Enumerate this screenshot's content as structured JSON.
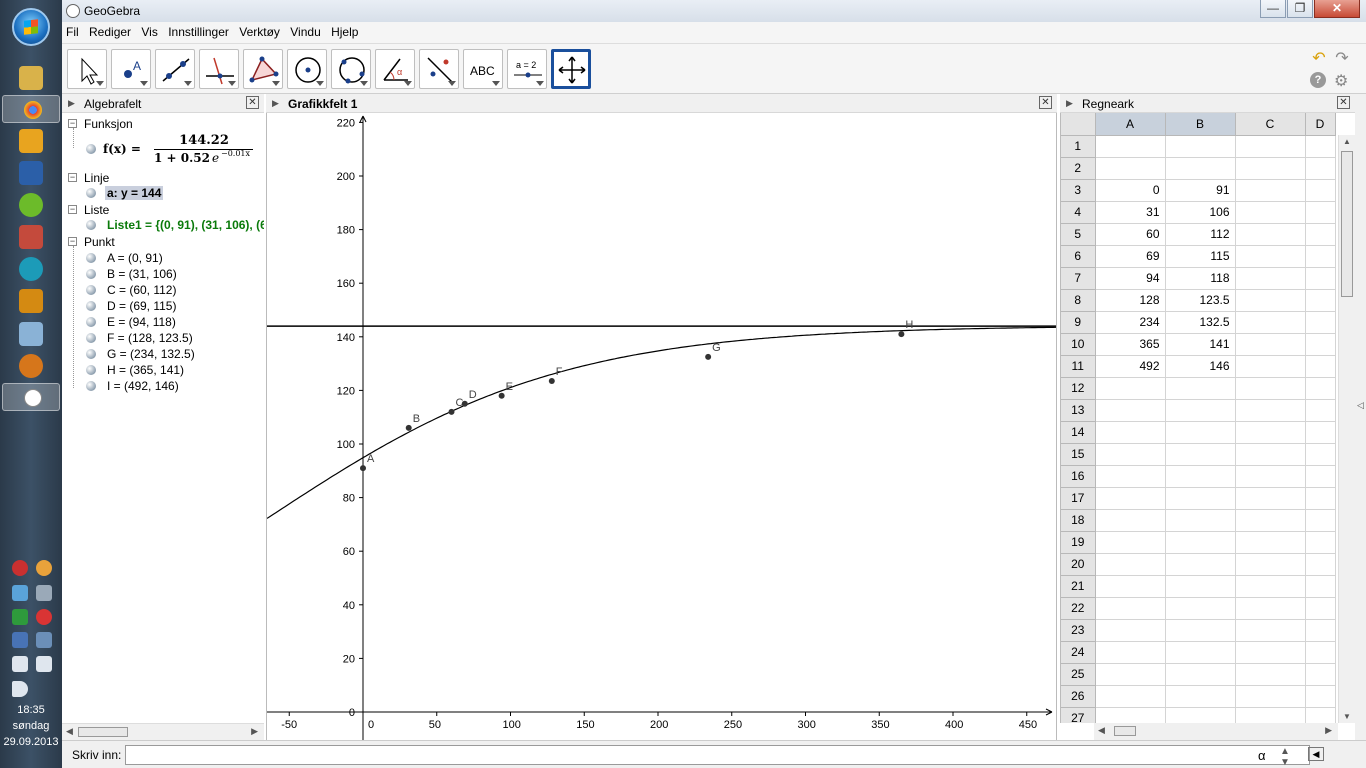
{
  "window": {
    "title": "GeoGebra",
    "minimize": "—",
    "maximize": "❐",
    "close": "✕"
  },
  "menu": [
    "Fil",
    "Rediger",
    "Vis",
    "Innstillinger",
    "Verktøy",
    "Vindu",
    "Hjelp"
  ],
  "toolbar": {
    "tools": [
      "move-tool",
      "point-tool",
      "line-tool",
      "perpendicular-tool",
      "polygon-tool",
      "circle-tool",
      "circle-three-points-tool",
      "angle-tool",
      "reflect-tool",
      "text-tool",
      "slider-tool",
      "move-graphics-tool"
    ],
    "text_tool_label": "ABC",
    "slider_tool_label": "a = 2",
    "undo": "↶",
    "redo": "↷",
    "help": "?",
    "settings": "⚙"
  },
  "algebra": {
    "title": "Algebrafelt",
    "categories": {
      "function": "Funksjon",
      "line": "Linje",
      "list": "Liste",
      "point": "Punkt"
    },
    "function_lhs": "f(x) =",
    "function_num": "144.22",
    "function_den": "1 + 0.52",
    "function_exp_base": "e",
    "function_exp": "−0.01x",
    "line_item": "a: y = 144",
    "list_item": "Liste1 = {(0, 91), (31, 106), (6",
    "points": [
      "A = (0, 91)",
      "B = (31, 106)",
      "C = (60, 112)",
      "D = (69, 115)",
      "E = (94, 118)",
      "F = (128, 123.5)",
      "G = (234, 132.5)",
      "H = (365, 141)",
      "I = (492, 146)"
    ]
  },
  "graphics": {
    "title": "Grafikkfelt 1",
    "x_ticks": [
      "-50",
      "0",
      "50",
      "100",
      "150",
      "200",
      "250",
      "300",
      "350",
      "400",
      "450"
    ],
    "y_ticks": [
      "0",
      "20",
      "40",
      "60",
      "80",
      "100",
      "120",
      "140",
      "160",
      "180",
      "200",
      "220"
    ],
    "point_labels": [
      "A",
      "B",
      "C",
      "D",
      "E",
      "F",
      "G",
      "H"
    ],
    "points": [
      [
        0,
        91
      ],
      [
        31,
        106
      ],
      [
        60,
        112
      ],
      [
        69,
        115
      ],
      [
        94,
        118
      ],
      [
        128,
        123.5
      ],
      [
        234,
        132.5
      ],
      [
        365,
        141
      ]
    ],
    "horizontal_line_y": 144,
    "function": {
      "L": 144.22,
      "a": 0.52,
      "k": 0.01
    }
  },
  "spreadsheet": {
    "title": "Regneark",
    "columns": [
      "A",
      "B",
      "C",
      "D"
    ],
    "rows": [
      [
        "1",
        "",
        ""
      ],
      [
        "2",
        "",
        ""
      ],
      [
        "3",
        "0",
        "91"
      ],
      [
        "4",
        "31",
        "106"
      ],
      [
        "5",
        "60",
        "112"
      ],
      [
        "6",
        "69",
        "115"
      ],
      [
        "7",
        "94",
        "118"
      ],
      [
        "8",
        "128",
        "123.5"
      ],
      [
        "9",
        "234",
        "132.5"
      ],
      [
        "10",
        "365",
        "141"
      ],
      [
        "11",
        "492",
        "146"
      ],
      [
        "12",
        "",
        ""
      ],
      [
        "13",
        "",
        ""
      ],
      [
        "14",
        "",
        ""
      ],
      [
        "15",
        "",
        ""
      ],
      [
        "16",
        "",
        ""
      ],
      [
        "17",
        "",
        ""
      ],
      [
        "18",
        "",
        ""
      ],
      [
        "19",
        "",
        ""
      ],
      [
        "20",
        "",
        ""
      ],
      [
        "21",
        "",
        ""
      ],
      [
        "22",
        "",
        ""
      ],
      [
        "23",
        "",
        ""
      ],
      [
        "24",
        "",
        ""
      ],
      [
        "25",
        "",
        ""
      ],
      [
        "26",
        "",
        ""
      ],
      [
        "27",
        "",
        ""
      ]
    ]
  },
  "input": {
    "label": "Skriv inn:",
    "value": "",
    "alpha": "α"
  },
  "taskbar": {
    "time": "18:35",
    "day": "søndag",
    "date": "29.09.2013"
  }
}
